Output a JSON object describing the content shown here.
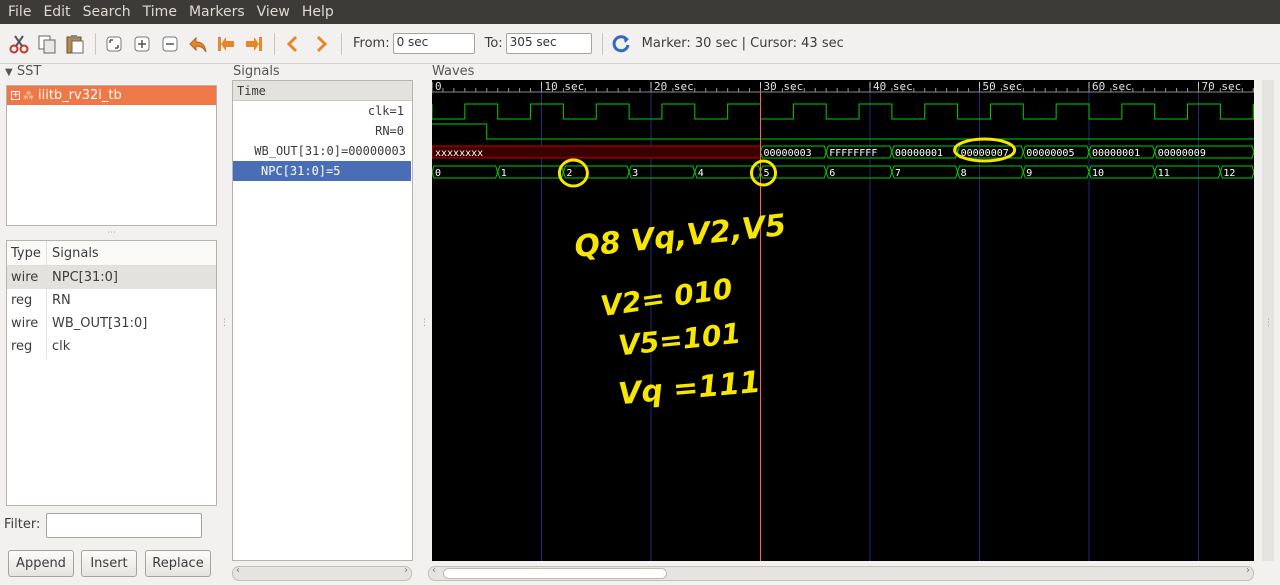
{
  "menu": [
    "File",
    "Edit",
    "Search",
    "Time",
    "Markers",
    "View",
    "Help"
  ],
  "toolbar": {
    "icons": [
      "cut-icon",
      "copy-icon",
      "paste-icon",
      "zoom-fit-icon",
      "zoom-in-icon",
      "zoom-out-icon",
      "undo-zoom-icon",
      "zoom-start-icon",
      "zoom-end-icon",
      "prev-edge-icon",
      "next-edge-icon"
    ],
    "from_label": "From:",
    "from_value": "0 sec",
    "to_label": "To:",
    "to_value": "305 sec",
    "reload_icon": "reload-icon",
    "status": "Marker: 30 sec  |  Cursor: 43 sec"
  },
  "sst": {
    "label": "SST",
    "root": "iiitb_rv32i_tb"
  },
  "signal_table": {
    "col_type": "Type",
    "col_signals": "Signals",
    "rows": [
      {
        "type": "wire",
        "name": "NPC[31:0]"
      },
      {
        "type": "reg",
        "name": "RN"
      },
      {
        "type": "wire",
        "name": "WB_OUT[31:0]"
      },
      {
        "type": "reg",
        "name": "clk"
      }
    ]
  },
  "filter_label": "Filter:",
  "buttons": {
    "append": "Append",
    "insert": "Insert",
    "replace": "Replace"
  },
  "signals_pane": {
    "label": "Signals",
    "time": "Time",
    "rows": [
      {
        "name": "clk",
        "value": "=1"
      },
      {
        "name": "RN",
        "value": "=0"
      },
      {
        "name": "WB_OUT[31:0]",
        "value": "=00000003"
      },
      {
        "name": "NPC[31:0]",
        "value": "=5"
      }
    ]
  },
  "waves": {
    "label": "Waves",
    "ticks": [
      {
        "t": 0,
        "label": "0"
      },
      {
        "t": 10,
        "label": "10 sec"
      },
      {
        "t": 20,
        "label": "20 sec"
      },
      {
        "t": 30,
        "label": "30 sec"
      },
      {
        "t": 40,
        "label": "40 sec"
      },
      {
        "t": 50,
        "label": "50 sec"
      },
      {
        "t": 60,
        "label": "60 sec"
      },
      {
        "t": 70,
        "label": "70 sec"
      }
    ],
    "marker_sec": 30,
    "clk_half_period_sec": 3,
    "rn_high_until_sec": 5,
    "wb_out": [
      {
        "start": 0,
        "end": 30,
        "value": "xxxxxxxx",
        "undefined": true
      },
      {
        "start": 30,
        "end": 36,
        "value": "00000003"
      },
      {
        "start": 36,
        "end": 42,
        "value": "FFFFFFFF"
      },
      {
        "start": 42,
        "end": 48,
        "value": "00000001"
      },
      {
        "start": 48,
        "end": 54,
        "value": "00000007"
      },
      {
        "start": 54,
        "end": 60,
        "value": "00000005"
      },
      {
        "start": 60,
        "end": 66,
        "value": "00000001"
      },
      {
        "start": 66,
        "end": 75.5,
        "value": "00000009"
      }
    ],
    "npc": [
      "0",
      "1",
      "2",
      "3",
      "4",
      "5",
      "6",
      "7",
      "8",
      "9",
      "10",
      "11",
      "12"
    ],
    "npc_period_sec": 6,
    "colors": {
      "green": "#00d000",
      "red": "#d00000",
      "grid": "#1e2a7a",
      "marker": "#ff6060",
      "ink": "#f7e600"
    }
  },
  "annotations": {
    "line1": "Q8 Vq,V2,V5",
    "line2": "V2= 010",
    "line3": "V5=101",
    "line4": "Vq =111"
  }
}
